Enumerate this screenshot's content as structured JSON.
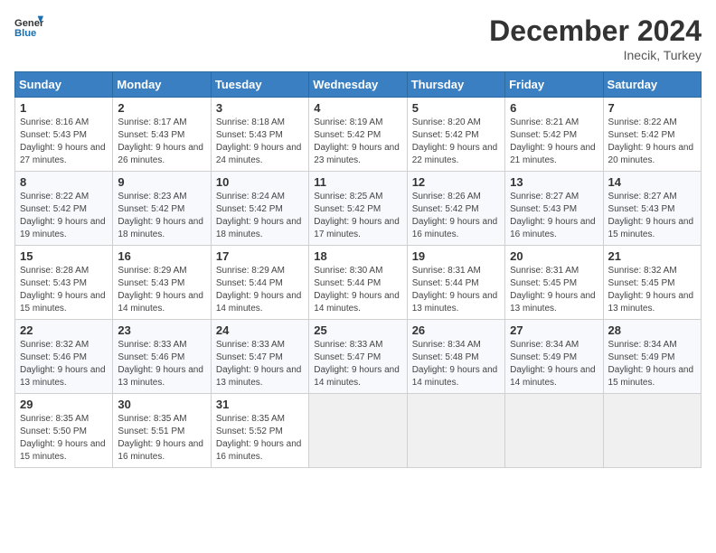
{
  "header": {
    "logo_general": "General",
    "logo_blue": "Blue",
    "month_title": "December 2024",
    "location": "Inecik, Turkey"
  },
  "weekdays": [
    "Sunday",
    "Monday",
    "Tuesday",
    "Wednesday",
    "Thursday",
    "Friday",
    "Saturday"
  ],
  "weeks": [
    [
      {
        "day": "1",
        "sunrise": "8:16 AM",
        "sunset": "5:43 PM",
        "daylight": "9 hours and 27 minutes."
      },
      {
        "day": "2",
        "sunrise": "8:17 AM",
        "sunset": "5:43 PM",
        "daylight": "9 hours and 26 minutes."
      },
      {
        "day": "3",
        "sunrise": "8:18 AM",
        "sunset": "5:43 PM",
        "daylight": "9 hours and 24 minutes."
      },
      {
        "day": "4",
        "sunrise": "8:19 AM",
        "sunset": "5:42 PM",
        "daylight": "9 hours and 23 minutes."
      },
      {
        "day": "5",
        "sunrise": "8:20 AM",
        "sunset": "5:42 PM",
        "daylight": "9 hours and 22 minutes."
      },
      {
        "day": "6",
        "sunrise": "8:21 AM",
        "sunset": "5:42 PM",
        "daylight": "9 hours and 21 minutes."
      },
      {
        "day": "7",
        "sunrise": "8:22 AM",
        "sunset": "5:42 PM",
        "daylight": "9 hours and 20 minutes."
      }
    ],
    [
      {
        "day": "8",
        "sunrise": "8:22 AM",
        "sunset": "5:42 PM",
        "daylight": "9 hours and 19 minutes."
      },
      {
        "day": "9",
        "sunrise": "8:23 AM",
        "sunset": "5:42 PM",
        "daylight": "9 hours and 18 minutes."
      },
      {
        "day": "10",
        "sunrise": "8:24 AM",
        "sunset": "5:42 PM",
        "daylight": "9 hours and 18 minutes."
      },
      {
        "day": "11",
        "sunrise": "8:25 AM",
        "sunset": "5:42 PM",
        "daylight": "9 hours and 17 minutes."
      },
      {
        "day": "12",
        "sunrise": "8:26 AM",
        "sunset": "5:42 PM",
        "daylight": "9 hours and 16 minutes."
      },
      {
        "day": "13",
        "sunrise": "8:27 AM",
        "sunset": "5:43 PM",
        "daylight": "9 hours and 16 minutes."
      },
      {
        "day": "14",
        "sunrise": "8:27 AM",
        "sunset": "5:43 PM",
        "daylight": "9 hours and 15 minutes."
      }
    ],
    [
      {
        "day": "15",
        "sunrise": "8:28 AM",
        "sunset": "5:43 PM",
        "daylight": "9 hours and 15 minutes."
      },
      {
        "day": "16",
        "sunrise": "8:29 AM",
        "sunset": "5:43 PM",
        "daylight": "9 hours and 14 minutes."
      },
      {
        "day": "17",
        "sunrise": "8:29 AM",
        "sunset": "5:44 PM",
        "daylight": "9 hours and 14 minutes."
      },
      {
        "day": "18",
        "sunrise": "8:30 AM",
        "sunset": "5:44 PM",
        "daylight": "9 hours and 14 minutes."
      },
      {
        "day": "19",
        "sunrise": "8:31 AM",
        "sunset": "5:44 PM",
        "daylight": "9 hours and 13 minutes."
      },
      {
        "day": "20",
        "sunrise": "8:31 AM",
        "sunset": "5:45 PM",
        "daylight": "9 hours and 13 minutes."
      },
      {
        "day": "21",
        "sunrise": "8:32 AM",
        "sunset": "5:45 PM",
        "daylight": "9 hours and 13 minutes."
      }
    ],
    [
      {
        "day": "22",
        "sunrise": "8:32 AM",
        "sunset": "5:46 PM",
        "daylight": "9 hours and 13 minutes."
      },
      {
        "day": "23",
        "sunrise": "8:33 AM",
        "sunset": "5:46 PM",
        "daylight": "9 hours and 13 minutes."
      },
      {
        "day": "24",
        "sunrise": "8:33 AM",
        "sunset": "5:47 PM",
        "daylight": "9 hours and 13 minutes."
      },
      {
        "day": "25",
        "sunrise": "8:33 AM",
        "sunset": "5:47 PM",
        "daylight": "9 hours and 14 minutes."
      },
      {
        "day": "26",
        "sunrise": "8:34 AM",
        "sunset": "5:48 PM",
        "daylight": "9 hours and 14 minutes."
      },
      {
        "day": "27",
        "sunrise": "8:34 AM",
        "sunset": "5:49 PM",
        "daylight": "9 hours and 14 minutes."
      },
      {
        "day": "28",
        "sunrise": "8:34 AM",
        "sunset": "5:49 PM",
        "daylight": "9 hours and 15 minutes."
      }
    ],
    [
      {
        "day": "29",
        "sunrise": "8:35 AM",
        "sunset": "5:50 PM",
        "daylight": "9 hours and 15 minutes."
      },
      {
        "day": "30",
        "sunrise": "8:35 AM",
        "sunset": "5:51 PM",
        "daylight": "9 hours and 16 minutes."
      },
      {
        "day": "31",
        "sunrise": "8:35 AM",
        "sunset": "5:52 PM",
        "daylight": "9 hours and 16 minutes."
      },
      null,
      null,
      null,
      null
    ]
  ]
}
